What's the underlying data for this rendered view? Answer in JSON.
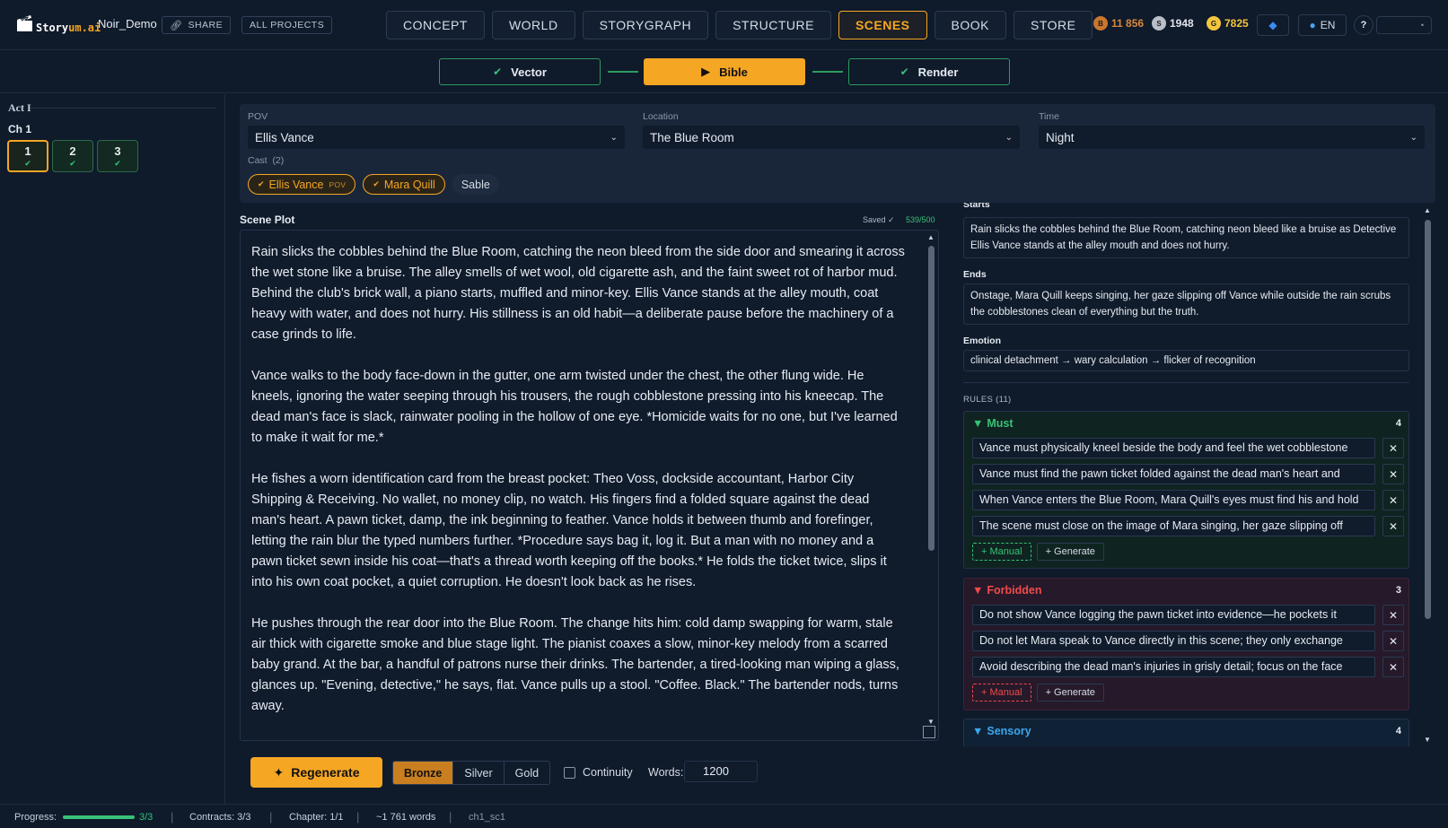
{
  "app": {
    "logo_main": "Story",
    "logo_accent": "um.ai",
    "project_name": "Noir_Demo",
    "share_label": "SHARE",
    "all_projects_label": "ALL PROJECTS"
  },
  "main_tabs": [
    {
      "label": "CONCEPT",
      "active": false
    },
    {
      "label": "WORLD",
      "active": false
    },
    {
      "label": "STORYGRAPH",
      "active": false
    },
    {
      "label": "STRUCTURE",
      "active": false
    },
    {
      "label": "SCENES",
      "active": true
    },
    {
      "label": "BOOK",
      "active": false
    },
    {
      "label": "STORE",
      "active": false
    }
  ],
  "currencies": {
    "bronze": {
      "glyph": "B",
      "value": "11 856"
    },
    "silver": {
      "glyph": "S",
      "value": "1948"
    },
    "gold": {
      "glyph": "G",
      "value": "7825"
    }
  },
  "topbar_right": {
    "language": "EN",
    "help": "?",
    "user_caret": "•"
  },
  "pipeline": [
    {
      "label": "Vector",
      "state": "done"
    },
    {
      "label": "Bible",
      "state": "active"
    },
    {
      "label": "Render",
      "state": "done"
    }
  ],
  "sidebar": {
    "act_title": "Act I",
    "chapter_title": "Ch 1",
    "scenes": [
      {
        "number": "1",
        "active": true
      },
      {
        "number": "2",
        "active": false
      },
      {
        "number": "3",
        "active": false
      }
    ]
  },
  "context": {
    "pov_label": "POV",
    "pov_value": "Ellis Vance",
    "location_label": "Location",
    "location_value": "The Blue Room",
    "time_label": "Time",
    "time_value": "Night",
    "cast_label": "Cast",
    "cast_count": "(2)",
    "cast": [
      {
        "name": "Ellis Vance",
        "selected": true,
        "pov_tag": "POV"
      },
      {
        "name": "Mara Quill",
        "selected": true,
        "pov_tag": ""
      },
      {
        "name": "Sable",
        "selected": false,
        "pov_tag": ""
      }
    ]
  },
  "scene_plot": {
    "title": "Scene Plot",
    "saved": "Saved ✓",
    "char_count": "539/500",
    "paragraphs": [
      "Rain slicks the cobbles behind the Blue Room, catching the neon bleed from the side door and smearing it across the wet stone like a bruise. The alley smells of wet wool, old cigarette ash, and the faint sweet rot of harbor mud. Behind the club's brick wall, a piano starts, muffled and minor-key. Ellis Vance stands at the alley mouth, coat heavy with water, and does not hurry. His stillness is an old habit—a deliberate pause before the machinery of a case grinds to life.",
      "Vance walks to the body face-down in the gutter, one arm twisted under the chest, the other flung wide. He kneels, ignoring the water seeping through his trousers, the rough cobblestone pressing into his kneecap. The dead man's face is slack, rainwater pooling in the hollow of one eye. *Homicide waits for no one, but I've learned to make it wait for me.*",
      "He fishes a worn identification card from the breast pocket: Theo Voss, dockside accountant, Harbor City Shipping & Receiving. No wallet, no money clip, no watch. His fingers find a folded square against the dead man's heart. A pawn ticket, damp, the ink beginning to feather. Vance holds it between thumb and forefinger, letting the rain blur the typed numbers further. *Procedure says bag it, log it. But a man with no money and a pawn ticket sewn inside his coat—that's a thread worth keeping off the books.* He folds the ticket twice, slips it into his own coat pocket, a quiet corruption. He doesn't look back as he rises.",
      "He pushes through the rear door into the Blue Room. The change hits him: cold damp swapping for warm, stale air thick with cigarette smoke and blue stage light. The pianist coaxes a slow, minor-key melody from a scarred baby grand. At the bar, a handful of patrons nurse their drinks. The bartender, a tired-looking man wiping a glass, glances up. \"Evening, detective,\" he says, flat. Vance pulls up a stool. \"Coffee. Black.\" The bartender nods, turns away."
    ]
  },
  "bible": {
    "starts_label": "Starts",
    "starts_text": "Rain slicks the cobbles behind the Blue Room, catching neon bleed like a bruise as Detective Ellis Vance stands at the alley mouth and does not hurry.",
    "ends_label": "Ends",
    "ends_text": "Onstage, Mara Quill keeps singing, her gaze slipping off Vance while outside the rain scrubs the cobblestones clean of everything but the truth.",
    "emotion_label": "Emotion",
    "emotion_text": "clinical detachment → wary calculation → flicker of recognition",
    "rules_title": "RULES (11)",
    "groups": {
      "must": {
        "title": "Must",
        "count": "4",
        "items": [
          "Vance must physically kneel beside the body and feel the wet cobblestone",
          "Vance must find the pawn ticket folded against the dead man's heart and",
          "When Vance enters the Blue Room, Mara Quill's eyes must find his and hold",
          "The scene must close on the image of Mara singing, her gaze slipping off"
        ],
        "manual": "+ Manual",
        "generate": "+ Generate"
      },
      "forbidden": {
        "title": "Forbidden",
        "count": "3",
        "items": [
          "Do not show Vance logging the pawn ticket into evidence—he pockets it",
          "Do not let Mara speak to Vance directly in this scene; they only exchange",
          "Avoid describing the dead man's injuries in grisly detail; focus on the face"
        ],
        "manual": "+ Manual",
        "generate": "+ Generate"
      },
      "sensory": {
        "title": "Sensory",
        "count": "4"
      }
    }
  },
  "generate_bar": {
    "regenerate": "Regenerate",
    "tiers": [
      {
        "label": "Bronze",
        "active": true
      },
      {
        "label": "Silver",
        "active": false
      },
      {
        "label": "Gold",
        "active": false
      }
    ],
    "continuity_label": "Continuity",
    "continuity_checked": false,
    "words_label": "Words:",
    "words_value": "1200"
  },
  "status_bar": {
    "progress_label": "Progress:",
    "progress_fraction": 1.0,
    "progress_value": "3/3",
    "contracts": "Contracts: 3/3",
    "chapter": "Chapter: 1/1",
    "words": "~1 761 words",
    "scene_id": "ch1_sc1"
  },
  "colors": {
    "background": "#0f1a2b",
    "accent": "#f5a623",
    "success": "#37c277",
    "danger": "#ef4b4b",
    "info": "#3da6ef"
  }
}
